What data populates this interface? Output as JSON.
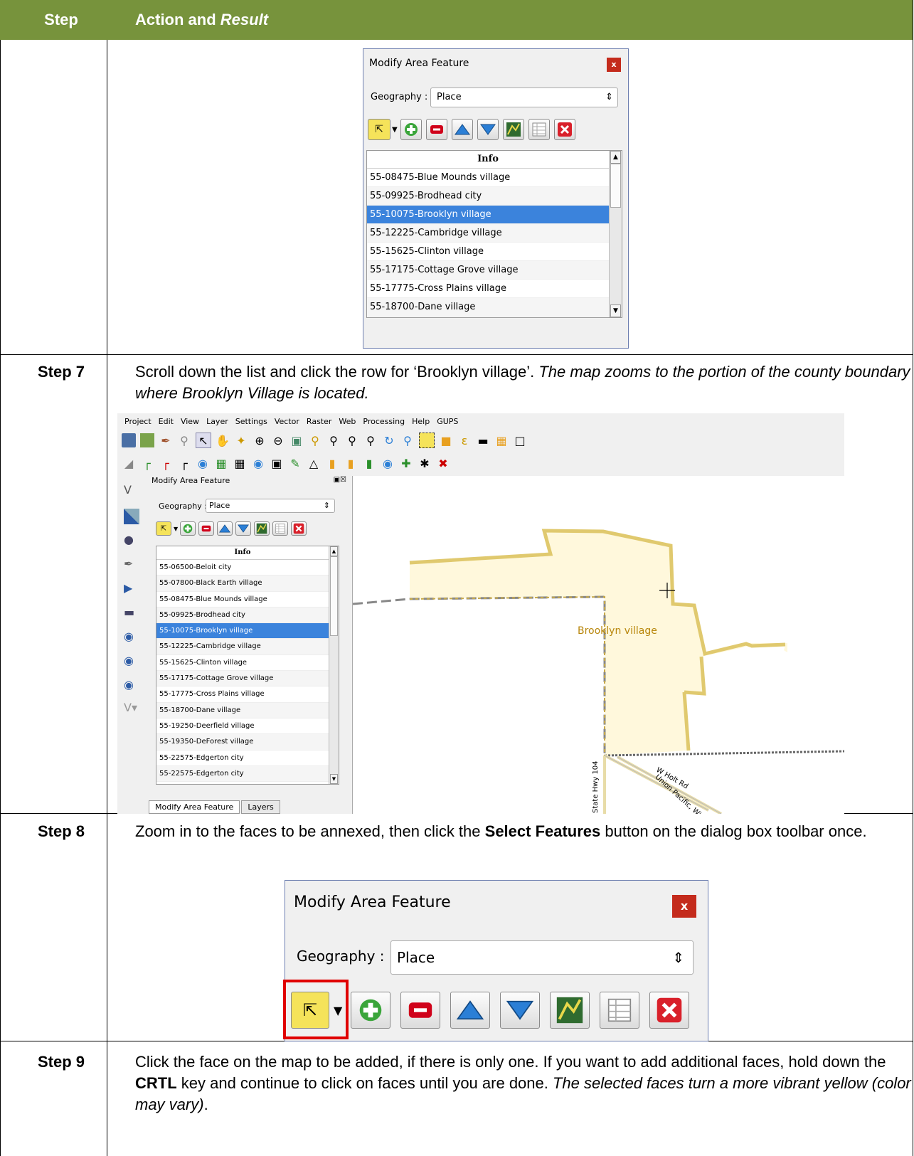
{
  "table": {
    "header": {
      "step": "Step",
      "action_prefix": "Action and ",
      "action_italic": "Result"
    },
    "step7": {
      "label": "Step 7",
      "text": "Scroll down the list and click the row for ‘Brooklyn village’. ",
      "italic": "The map zooms to the portion of the county boundary where Brooklyn Village is located."
    },
    "step8": {
      "label": "Step 8",
      "text_before": "Zoom in to the faces to be annexed, then click the ",
      "bold": "Select Features",
      "text_after": " button on the dialog box toolbar once."
    },
    "step9": {
      "label": "Step 9",
      "text_before": "Click the face on the map to be added, if there is only one. If you want to add additional faces, hold down the ",
      "bold": "CRTL",
      "text_middle": " key and continue to click on faces until you are done. ",
      "italic": "The selected faces turn a more vibrant yellow (color may vary)",
      "text_after": "."
    }
  },
  "dialog1": {
    "title": "Modify Area Feature",
    "close": "x",
    "geography_label": "Geography :",
    "geography_value": "Place",
    "list_header": "Info",
    "rows": [
      "55-08475-Blue Mounds village",
      "55-09925-Brodhead city",
      "55-10075-Brooklyn village",
      "55-12225-Cambridge village",
      "55-15625-Clinton village",
      "55-17175-Cottage Grove village",
      "55-17775-Cross Plains village",
      "55-18700-Dane village"
    ],
    "selected_index": 2
  },
  "qgis": {
    "menu": [
      "Project",
      "Edit",
      "View",
      "Layer",
      "Settings",
      "Vector",
      "Raster",
      "Web",
      "Processing",
      "Help",
      "GUPS"
    ],
    "panel_title": "Modify Area Feature",
    "geography_label": "Geography :",
    "geography_value": "Place",
    "list_header": "Info",
    "rows": [
      "55-06500-Beloit city",
      "55-07800-Black Earth village",
      "55-08475-Blue Mounds village",
      "55-09925-Brodhead city",
      "55-10075-Brooklyn village",
      "55-12225-Cambridge village",
      "55-15625-Clinton village",
      "55-17175-Cottage Grove village",
      "55-17775-Cross Plains village",
      "55-18700-Dane village",
      "55-19250-Deerfield village",
      "55-19350-DeForest village",
      "55-22575-Edgerton city",
      "55-22575-Edgerton city"
    ],
    "selected_index": 4,
    "tabs": [
      "Modify Area Feature",
      "Layers"
    ],
    "map_labels": {
      "place": "Brooklyn village",
      "rail": "Union Pacific, Wis & Southern",
      "road": "W Holt Rd",
      "hwy": "State Hwy 104"
    }
  },
  "dialog2": {
    "title": "Modify Area Feature",
    "close": "x",
    "geography_label": "Geography :",
    "geography_value": "Place"
  },
  "colors": {
    "header_bg": "#77933c",
    "selection": "#3b83dc",
    "boundary": "#e0c96e",
    "fill": "#fff8dc",
    "highlight": "#e00000"
  }
}
